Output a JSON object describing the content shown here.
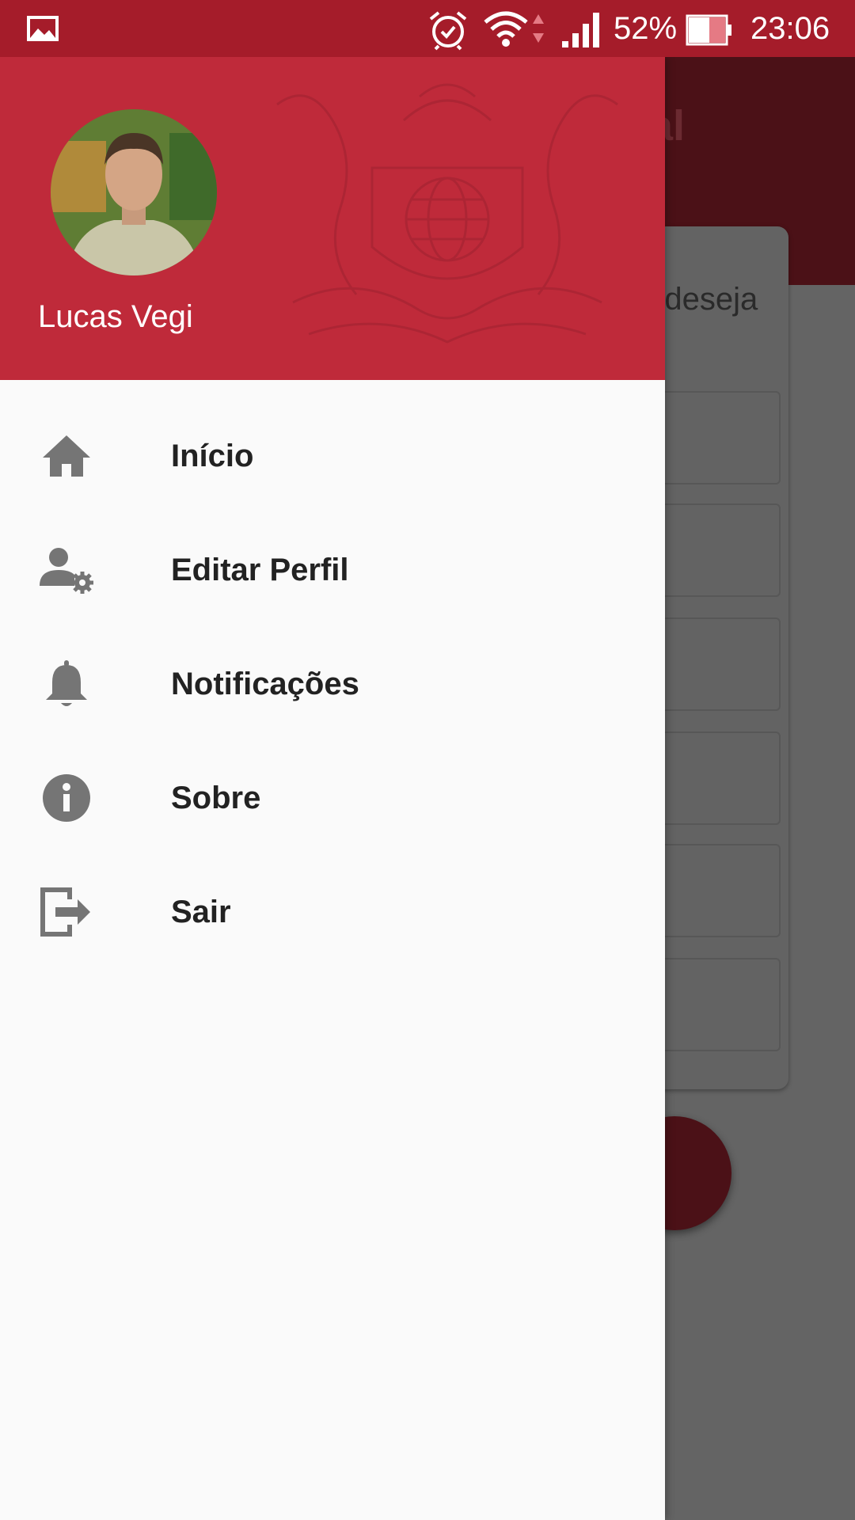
{
  "status_bar": {
    "battery_percent": "52%",
    "time": "23:06",
    "icons": [
      "gallery-icon",
      "alarm-icon",
      "wifi-icon",
      "data-arrows-icon",
      "signal-icon",
      "battery-icon"
    ]
  },
  "background": {
    "title_fragment": "al",
    "card_text_fragment": "e deseja"
  },
  "drawer": {
    "user_name": "Lucas Vegi",
    "items": [
      {
        "label": "Início",
        "icon": "home-icon"
      },
      {
        "label": "Editar Perfil",
        "icon": "user-settings-icon"
      },
      {
        "label": "Notificações",
        "icon": "bell-icon"
      },
      {
        "label": "Sobre",
        "icon": "info-icon"
      },
      {
        "label": "Sair",
        "icon": "exit-icon"
      }
    ]
  },
  "colors": {
    "status_bar": "#a51c2a",
    "drawer_header": "#bf2a3a",
    "scrim": "#646464",
    "icon_gray": "#757575"
  }
}
